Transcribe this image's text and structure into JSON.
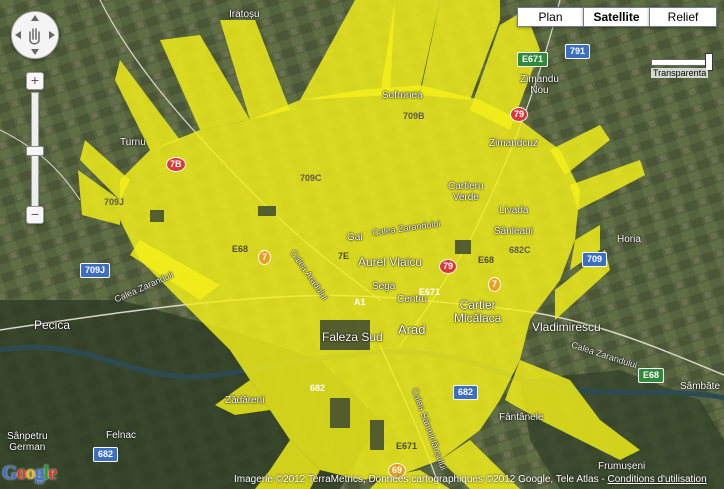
{
  "map_type_controls": [
    {
      "label": "Plan",
      "active": false
    },
    {
      "label": "Satellite",
      "active": true
    },
    {
      "label": "Relief",
      "active": false
    }
  ],
  "zoom": {
    "plus_label": "+",
    "minus_label": "−"
  },
  "opacity_slider": {
    "label": "Transparenta",
    "value": 1.0
  },
  "logo": {
    "letters": [
      "G",
      "o",
      "o",
      "g",
      "l",
      "e"
    ]
  },
  "attribution": {
    "text": "Imagerie ©2012 TerraMetrics, Données cartographiques ©2012 Google, Tele Atlas -",
    "link": "Conditions d'utilisation"
  },
  "colors": {
    "coverage": "#f4f01a",
    "imagery": "#4f5b3a"
  },
  "places": {
    "iratosu": "Iratoșu",
    "sofronea": "Sofronea",
    "zimandu_nou": "Zimandu\nNou",
    "zimandcuz": "Zimandcuz",
    "turnu": "Turnu",
    "cartieru_verde": "Cartieru\nVerde",
    "livada": "Livada",
    "sanleani": "Sânleani",
    "horia": "Horia",
    "gai": "Gai",
    "aurel_vlaicu": "Aurel Vlaicu",
    "sega": "Sega",
    "centru": "Centru",
    "cartier_micalaca": "Cartier\nMicălaca",
    "vladimirescu": "Vladimirescu",
    "pecica": "Pecica",
    "faleza_sud": "Faleza Sud",
    "arad": "Arad",
    "zadareni": "Zădăreni",
    "fantanele": "Fântânele",
    "sanpetru_german": "Sânpetru\nGerman",
    "felnac": "Felnac",
    "frumuseni": "Frumușeni",
    "sambateni": "Sâmbăte"
  },
  "roads": {
    "calea_zaranduli": "Calea Zaranduli",
    "calea_zarandului_1": "Calea Zarandului",
    "calea_zarandului_2": "Calea Zarandului",
    "calea_aradului": "Calea Aradului",
    "calea_sanmiclausului": "Calea Sânmiclăușului"
  },
  "shields": {
    "e671_top": "E671",
    "s791": "791",
    "s79_top": "79",
    "s709b": "709B",
    "s7b": "7B",
    "s709c": "709C",
    "s709j_a": "709J",
    "s709j_b": "709J",
    "e68_left": "E68",
    "s7_left": "7",
    "s7e": "7E",
    "s7_center": "7",
    "s79_center": "79",
    "e68_center": "E68",
    "s682c": "682C",
    "s709_right": "709",
    "s7_right": "7",
    "a1": "A1",
    "e671_center": "E671",
    "e68_right": "E68",
    "s682_left": "682",
    "s682_center": "682",
    "s682_bottom": "682",
    "e671_bottom": "E671",
    "s69": "69"
  }
}
